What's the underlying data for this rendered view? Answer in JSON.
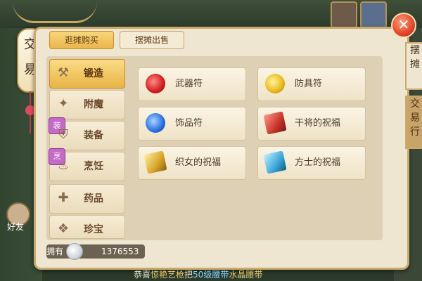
{
  "window": {
    "side_label_chars": [
      "交",
      "易"
    ],
    "close_glyph": "✕"
  },
  "tabs": [
    {
      "label": "逛摊购买",
      "active": true
    },
    {
      "label": "摆摊出售",
      "active": false
    }
  ],
  "categories": [
    {
      "label": "锻造",
      "icon": "hammer-icon",
      "active": true
    },
    {
      "label": "附魔",
      "icon": "wand-icon",
      "active": false
    },
    {
      "label": "装备",
      "icon": "armor-icon",
      "active": false,
      "badge": "装"
    },
    {
      "label": "烹饪",
      "icon": "cookpot-icon",
      "active": false,
      "badge": "烹"
    },
    {
      "label": "药品",
      "icon": "medicine-icon",
      "active": false
    },
    {
      "label": "珍宝",
      "icon": "treasure-icon",
      "active": false
    }
  ],
  "items": [
    {
      "name": "武器符",
      "icon": "red-talisman-icon"
    },
    {
      "name": "防具符",
      "icon": "yellow-talisman-icon"
    },
    {
      "name": "饰品符",
      "icon": "blue-talisman-icon"
    },
    {
      "name": "干将的祝福",
      "icon": "red-scroll-icon"
    },
    {
      "name": "织女的祝福",
      "icon": "gold-scroll-icon"
    },
    {
      "name": "方士的祝福",
      "icon": "blue-scroll-icon"
    }
  ],
  "holding": {
    "label": "拥有",
    "amount": "1376553",
    "currency_icon": "silver-coin-icon"
  },
  "side_tabs": [
    {
      "chars": [
        "摆",
        "摊"
      ]
    },
    {
      "chars": [
        "交",
        "易",
        "行"
      ]
    }
  ],
  "friend": {
    "label": "好友"
  },
  "ticker": {
    "prefix": "恭喜",
    "name": "惊艳艺枪",
    "mid": "把",
    "item": "50级腰带",
    "suffix": "水晶腰带"
  },
  "colors": {
    "panel_bg": "#efe6d2",
    "accent_gold": "#e9b64b",
    "close_red": "#e2472a"
  }
}
